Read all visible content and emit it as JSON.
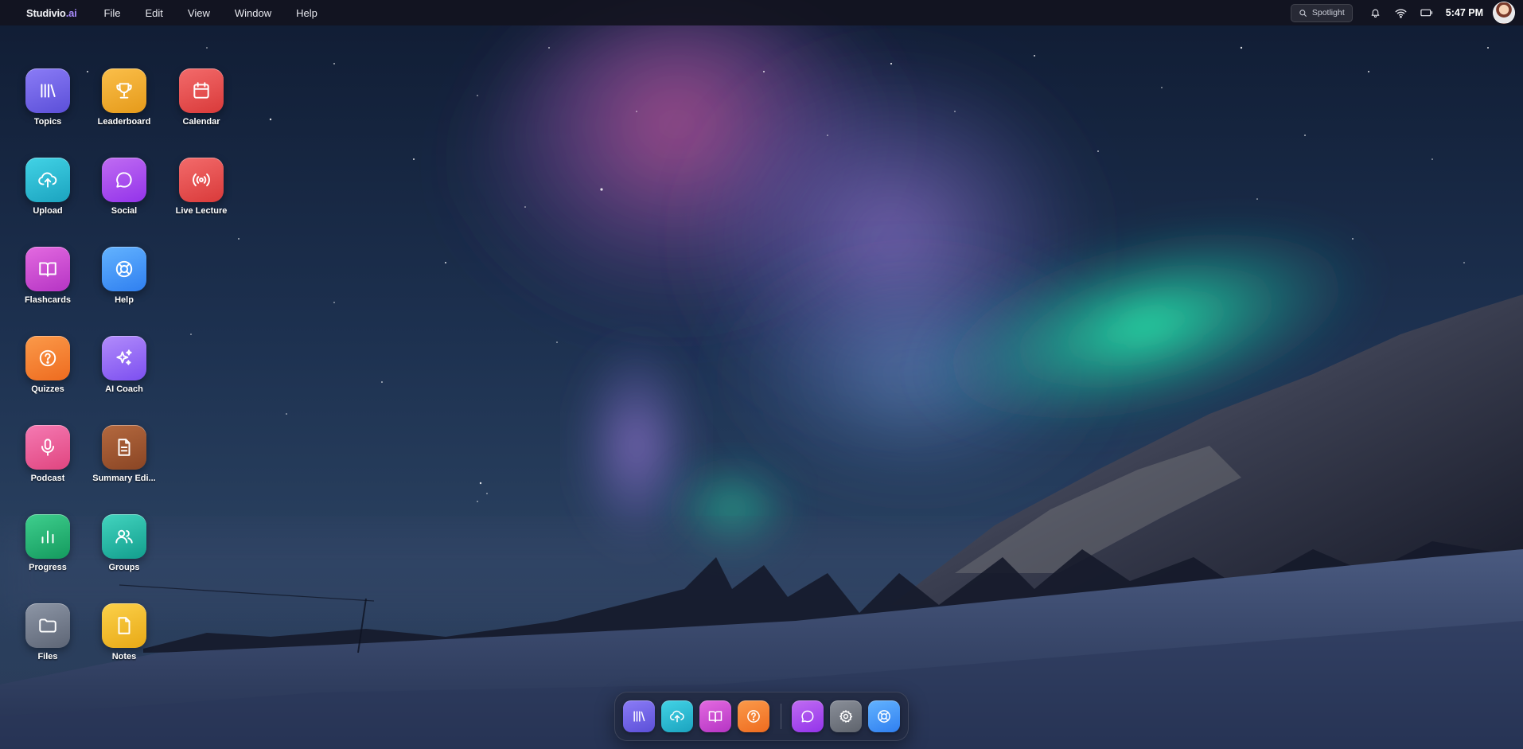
{
  "menubar": {
    "brand_prefix": "Studivio",
    "brand_suffix": ".ai",
    "menus": [
      "File",
      "Edit",
      "View",
      "Window",
      "Help"
    ],
    "spotlight_placeholder": "Spotlight",
    "clock": "5:47 PM",
    "status_icons": [
      "bell-icon",
      "wifi-icon",
      "battery-icon"
    ]
  },
  "desktop": {
    "icons": [
      {
        "label": "Topics",
        "icon": "library-icon",
        "color": "#6d5ee8"
      },
      {
        "label": "Leaderboard",
        "icon": "trophy-icon",
        "color": "#f2ac2e"
      },
      {
        "label": "Calendar",
        "icon": "calendar-icon",
        "color": "#e44b4b"
      },
      {
        "label": "Upload",
        "icon": "cloud-upload-icon",
        "color": "#2bbad3"
      },
      {
        "label": "Social",
        "icon": "chat-bubble-icon",
        "color": "#a855f7"
      },
      {
        "label": "Live Lecture",
        "icon": "broadcast-icon",
        "color": "#e44b4b"
      },
      {
        "label": "Flashcards",
        "icon": "open-book-icon",
        "color": "#c84fd2"
      },
      {
        "label": "Help",
        "icon": "lifebuoy-icon",
        "color": "#3b8ef5"
      },
      {
        "label": "Quizzes",
        "icon": "question-circle-icon",
        "color": "#f47d2e"
      },
      {
        "label": "AI Coach",
        "icon": "sparkles-icon",
        "color": "#8f63f5"
      },
      {
        "label": "Podcast",
        "icon": "microphone-icon",
        "color": "#ea5a96"
      },
      {
        "label": "Summary Edi...",
        "icon": "document-icon",
        "color": "#9c5430"
      },
      {
        "label": "Progress",
        "icon": "bar-chart-icon",
        "color": "#26b574"
      },
      {
        "label": "Groups",
        "icon": "users-icon",
        "color": "#26b9a6"
      },
      {
        "label": "Files",
        "icon": "folder-icon",
        "color": "#737c8c"
      },
      {
        "label": "Notes",
        "icon": "note-icon",
        "color": "#f0bb2c"
      }
    ]
  },
  "dock": {
    "items": [
      {
        "name": "Topics",
        "icon": "library-icon"
      },
      {
        "name": "Upload",
        "icon": "cloud-upload-icon"
      },
      {
        "name": "Flashcards",
        "icon": "open-book-icon"
      },
      {
        "name": "Quizzes",
        "icon": "question-circle-icon"
      },
      {
        "name": "Social",
        "icon": "chat-bubble-icon"
      },
      {
        "name": "Settings",
        "icon": "gear-icon"
      },
      {
        "name": "Help",
        "icon": "lifebuoy-icon"
      }
    ]
  }
}
